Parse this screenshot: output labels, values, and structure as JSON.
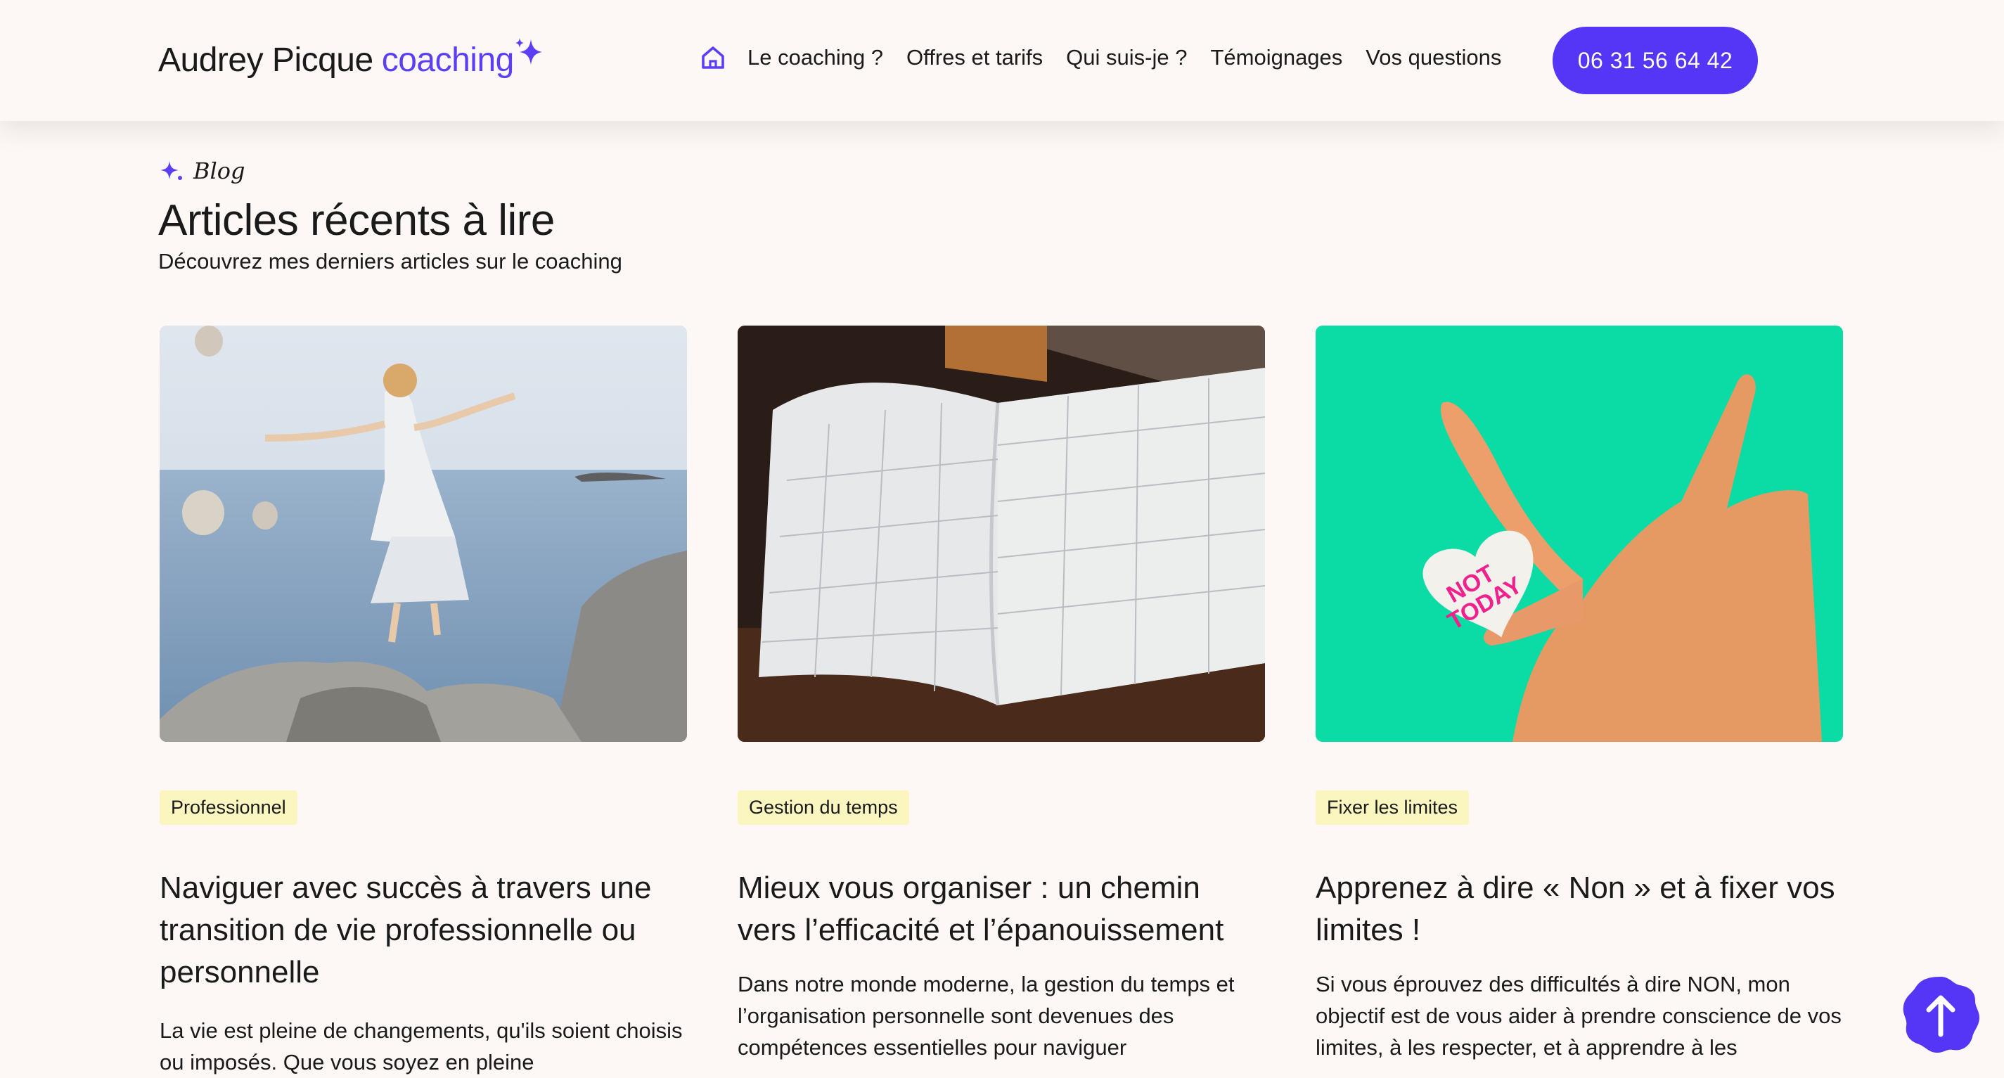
{
  "brand": {
    "name": "Audrey Picque",
    "accent": "coaching",
    "accent_color": "#5b3ff5"
  },
  "nav": {
    "home_icon": "home-icon",
    "items": [
      "Le coaching ?",
      "Offres et tarifs",
      "Qui suis-je ?",
      "Témoignages",
      "Vos questions"
    ],
    "cta_phone": "06 31 56 64 42",
    "cta_color": "#5535f6"
  },
  "section": {
    "eyebrow": "Blog",
    "title": "Articles récents à lire",
    "subtitle": "Découvrez mes derniers articles sur le coaching"
  },
  "articles": [
    {
      "tag": "Professionnel",
      "title": "Naviguer avec succès à travers une transition de vie professionnelle ou personnelle",
      "excerpt": "La vie est pleine de changements, qu'ils soient choisis ou imposés. Que vous soyez en pleine",
      "image": "woman-jumping-by-sea-photo"
    },
    {
      "tag": "Gestion du temps",
      "title": "Mieux vous organiser : un chemin vers l’efficacité et l’épanouissement",
      "excerpt": "Dans notre monde moderne, la gestion du temps et l’organisation personnelle sont devenues des compétences essentielles pour naviguer",
      "image": "open-planner-calendar-photo"
    },
    {
      "tag": "Fixer les limites",
      "title": "Apprenez à dire « Non » et à fixer vos limites !",
      "excerpt": "Si vous éprouvez des difficultés à dire NON, mon objectif est de vous aider à prendre conscience de vos limites, à les respecter, et à apprendre à les",
      "image": "hand-holding-heart-candy-photo",
      "image_text": [
        "NOT",
        "TODAY"
      ]
    }
  ],
  "tag_color": "#fbf5bf",
  "back_to_top_icon": "arrow-up-icon"
}
